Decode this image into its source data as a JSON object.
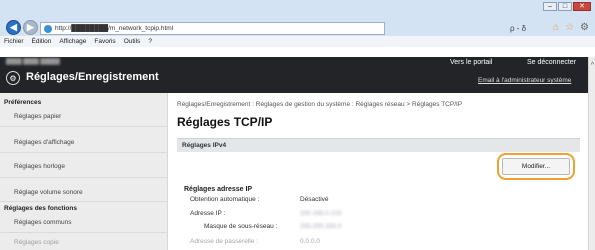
{
  "browser": {
    "address": "http://████████/m_network_tcpip.html",
    "address_ctrl": "ρ - δ",
    "menu": [
      "Fichier",
      "Édition",
      "Affichage",
      "Favoris",
      "Outils",
      "?"
    ]
  },
  "header": {
    "device_line": "████  ████  █████",
    "title": "Réglages/Enregistrement",
    "portal": "Vers le portail",
    "logout": "Se déconnecter",
    "email_admin": "Email à l'administrateur système"
  },
  "sidebar": {
    "categories": [
      "Préférences",
      "Réglages des fonctions"
    ],
    "preferences_items": [
      "Réglages papier",
      "Réglages d'affichage",
      "Réglages horloge",
      "Réglage volume sonore"
    ],
    "functions_items": [
      "Réglages communs",
      "Réglages copie"
    ]
  },
  "main": {
    "breadcrumb": "Réglages/Enregistrement : Réglages de gestion du système : Réglages réseau > Réglages TCP/IP",
    "title": "Réglages TCP/IP",
    "section": "Réglages IPv4",
    "modify_button": "Modifier...",
    "group": "Réglages adresse IP",
    "rows": [
      {
        "label": "Obtention automatique :",
        "value": "Désactivé"
      },
      {
        "label": "Adresse IP :",
        "value": "192.168.0.215"
      },
      {
        "label": "Masque de sous-réseau :",
        "value": "255.255.255.0"
      },
      {
        "label": "Adresse de passerelle :",
        "value": "0.0.0.0"
      }
    ]
  },
  "colors": {
    "highlight": "#f0a030",
    "header_bg": "#222427",
    "sidebar_bg": "#ececec"
  }
}
